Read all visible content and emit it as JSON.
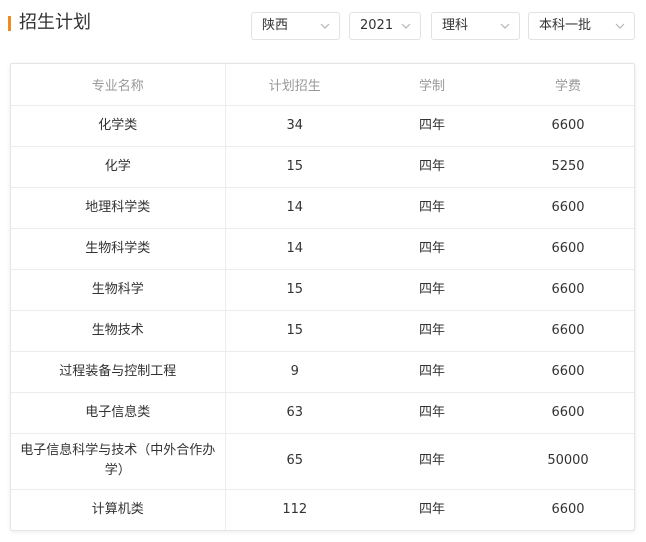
{
  "header": {
    "title": "招生计划",
    "filters": {
      "province": "陕西",
      "year": "2021",
      "subject_type": "理科",
      "batch": "本科一批"
    }
  },
  "colors": {
    "accent": "#f08a24"
  },
  "table": {
    "columns": [
      "专业名称",
      "计划招生",
      "学制",
      "学费"
    ],
    "rows": [
      {
        "major": "化学类",
        "plan": "34",
        "duration": "四年",
        "fee": "6600"
      },
      {
        "major": "化学",
        "plan": "15",
        "duration": "四年",
        "fee": "5250"
      },
      {
        "major": "地理科学类",
        "plan": "14",
        "duration": "四年",
        "fee": "6600"
      },
      {
        "major": "生物科学类",
        "plan": "14",
        "duration": "四年",
        "fee": "6600"
      },
      {
        "major": "生物科学",
        "plan": "15",
        "duration": "四年",
        "fee": "6600"
      },
      {
        "major": "生物技术",
        "plan": "15",
        "duration": "四年",
        "fee": "6600"
      },
      {
        "major": "过程装备与控制工程",
        "plan": "9",
        "duration": "四年",
        "fee": "6600"
      },
      {
        "major": "电子信息类",
        "plan": "63",
        "duration": "四年",
        "fee": "6600"
      },
      {
        "major": "电子信息科学与技术（中外合作办学）",
        "plan": "65",
        "duration": "四年",
        "fee": "50000"
      },
      {
        "major": "计算机类",
        "plan": "112",
        "duration": "四年",
        "fee": "6600"
      }
    ]
  }
}
